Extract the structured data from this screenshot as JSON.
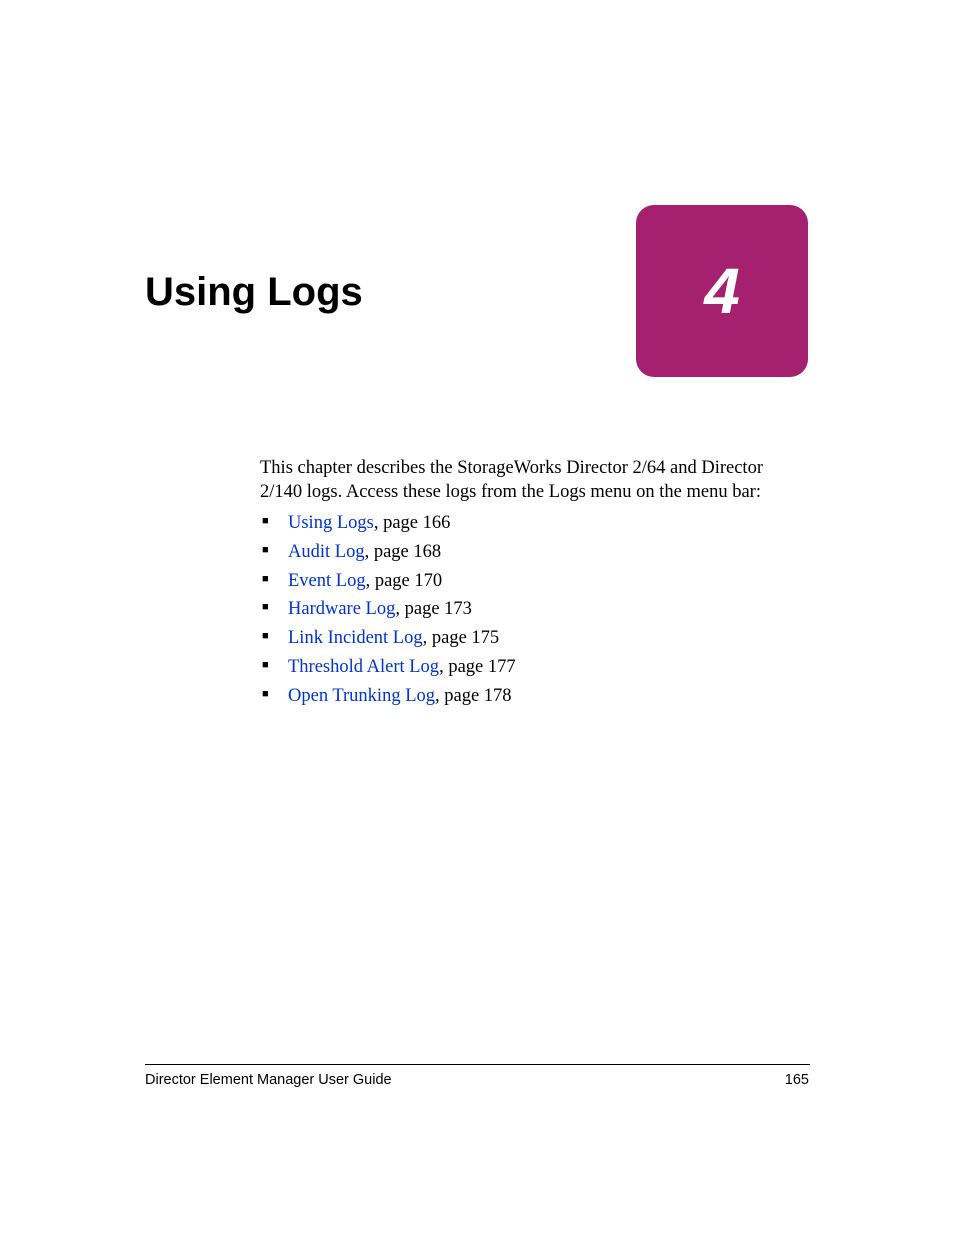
{
  "chapter": {
    "title": "Using Logs",
    "number": "4"
  },
  "intro": "This chapter describes the StorageWorks Director 2/64 and Director 2/140 logs. Access these logs from the Logs menu on the menu bar:",
  "toc": [
    {
      "link": "Using Logs",
      "suffix": ", page 166"
    },
    {
      "link": "Audit Log",
      "suffix": ", page 168"
    },
    {
      "link": "Event Log",
      "suffix": ", page 170"
    },
    {
      "link": "Hardware Log",
      "suffix": ", page 173"
    },
    {
      "link": "Link Incident Log",
      "suffix": ", page 175"
    },
    {
      "link": "Threshold Alert Log",
      "suffix": ", page 177"
    },
    {
      "link": "Open Trunking Log",
      "suffix": ", page 178"
    }
  ],
  "footer": {
    "guide": "Director Element Manager User Guide",
    "page": "165"
  }
}
